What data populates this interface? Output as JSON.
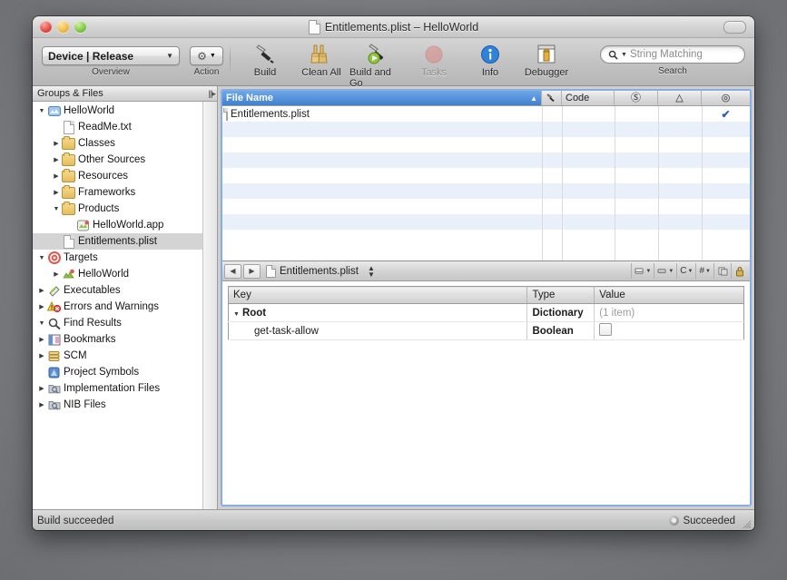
{
  "window": {
    "title": "Entitlements.plist – HelloWorld",
    "title_icon": "document-icon"
  },
  "toolbar": {
    "overview": {
      "value": "Device | Release",
      "caption": "Overview"
    },
    "action": {
      "caption": "Action",
      "icon": "gear-icon"
    },
    "buttons": [
      {
        "label": "Build",
        "icon": "hammer-icon",
        "disabled": false
      },
      {
        "label": "Clean All",
        "icon": "brooms-icon",
        "disabled": false
      },
      {
        "label": "Build and Go",
        "icon": "hammer-play-icon",
        "disabled": false
      },
      {
        "label": "Tasks",
        "icon": "stop-icon",
        "disabled": true
      },
      {
        "label": "Info",
        "icon": "info-icon",
        "disabled": false
      },
      {
        "label": "Debugger",
        "icon": "debugger-icon",
        "disabled": false
      }
    ],
    "search": {
      "placeholder": "String Matching",
      "caption": "Search",
      "icon": "search-icon"
    }
  },
  "sidebar": {
    "header": "Groups & Files",
    "items": [
      {
        "label": "HelloWorld",
        "indent": 0,
        "twisty": "open",
        "icon": "project-icon",
        "selected": false
      },
      {
        "label": "ReadMe.txt",
        "indent": 1,
        "twisty": "none",
        "icon": "text-file-icon",
        "selected": false
      },
      {
        "label": "Classes",
        "indent": 1,
        "twisty": "closed",
        "icon": "folder-icon",
        "selected": false
      },
      {
        "label": "Other Sources",
        "indent": 1,
        "twisty": "closed",
        "icon": "folder-icon",
        "selected": false
      },
      {
        "label": "Resources",
        "indent": 1,
        "twisty": "closed",
        "icon": "folder-icon",
        "selected": false
      },
      {
        "label": "Frameworks",
        "indent": 1,
        "twisty": "closed",
        "icon": "folder-icon",
        "selected": false
      },
      {
        "label": "Products",
        "indent": 1,
        "twisty": "open",
        "icon": "folder-icon",
        "selected": false
      },
      {
        "label": "HelloWorld.app",
        "indent": 2,
        "twisty": "none",
        "icon": "app-icon",
        "selected": false
      },
      {
        "label": "Entitlements.plist",
        "indent": 1,
        "twisty": "none",
        "icon": "plist-file-icon",
        "selected": true
      },
      {
        "label": "Targets",
        "indent": 0,
        "twisty": "open",
        "icon": "target-icon",
        "selected": false
      },
      {
        "label": "HelloWorld",
        "indent": 1,
        "twisty": "closed",
        "icon": "target-app-icon",
        "selected": false
      },
      {
        "label": "Executables",
        "indent": 0,
        "twisty": "closed",
        "icon": "executable-icon",
        "selected": false
      },
      {
        "label": "Errors and Warnings",
        "indent": 0,
        "twisty": "closed",
        "icon": "warning-icon",
        "selected": false
      },
      {
        "label": "Find Results",
        "indent": 0,
        "twisty": "open",
        "icon": "magnifier-icon",
        "selected": false
      },
      {
        "label": "Bookmarks",
        "indent": 0,
        "twisty": "closed",
        "icon": "book-icon",
        "selected": false
      },
      {
        "label": "SCM",
        "indent": 0,
        "twisty": "closed",
        "icon": "scm-icon",
        "selected": false
      },
      {
        "label": "Project Symbols",
        "indent": 0,
        "twisty": "none",
        "icon": "symbols-icon",
        "selected": false
      },
      {
        "label": "Implementation Files",
        "indent": 0,
        "twisty": "closed",
        "icon": "smartfolder-icon",
        "selected": false
      },
      {
        "label": "NIB Files",
        "indent": 0,
        "twisty": "closed",
        "icon": "smartfolder-icon",
        "selected": false
      }
    ]
  },
  "file_list": {
    "columns": [
      {
        "label": "File Name",
        "icon": "",
        "sorted": true,
        "sort_arrow": "▲"
      },
      {
        "label": "",
        "icon": "hammer-icon"
      },
      {
        "label": "Code",
        "icon": ""
      },
      {
        "label": "",
        "icon": "error-icon"
      },
      {
        "label": "",
        "icon": "warning-triangle-icon"
      },
      {
        "label": "",
        "icon": "target-bullseye-icon"
      }
    ],
    "rows": [
      {
        "name": "Entitlements.plist",
        "icon": "plist-file-icon",
        "code": "",
        "errors": "",
        "warnings": "",
        "target_checked": true
      }
    ],
    "empty_rows": 8
  },
  "editor": {
    "nav": {
      "back_icon": "back-arrow-icon",
      "forward_icon": "forward-arrow-icon",
      "file_icon": "document-icon",
      "file_name": "Entitlements.plist",
      "stepper_icon": "up-down-stepper-icon",
      "right_icons": [
        {
          "name": "popup-bookmarks-icon",
          "label": ""
        },
        {
          "name": "function-popup-icon",
          "label": ""
        },
        {
          "name": "class-popup-icon",
          "label": "C"
        },
        {
          "name": "counterpart-popup-icon",
          "label": "#"
        },
        {
          "name": "split-editor-icon",
          "label": ""
        },
        {
          "name": "lock-icon",
          "label": ""
        }
      ]
    },
    "plist": {
      "columns": [
        "Key",
        "Type",
        "Value"
      ],
      "rows": [
        {
          "key": "Root",
          "type": "Dictionary",
          "value": "(1 item)",
          "indent": 0,
          "twisty": "open",
          "value_kind": "muted-text"
        },
        {
          "key": "get-task-allow",
          "type": "Boolean",
          "value": "",
          "indent": 1,
          "twisty": "none",
          "value_kind": "checkbox",
          "checked": false
        }
      ]
    }
  },
  "status_bar": {
    "left": "Build succeeded",
    "right": "Succeeded",
    "right_icon": "status-dot-icon"
  },
  "colors": {
    "selection_blue": "#3f7fd0",
    "focus_ring": "#86aee0",
    "row_stripe": "#eaf0fa",
    "sidebar_selection": "#d4d4d4"
  }
}
